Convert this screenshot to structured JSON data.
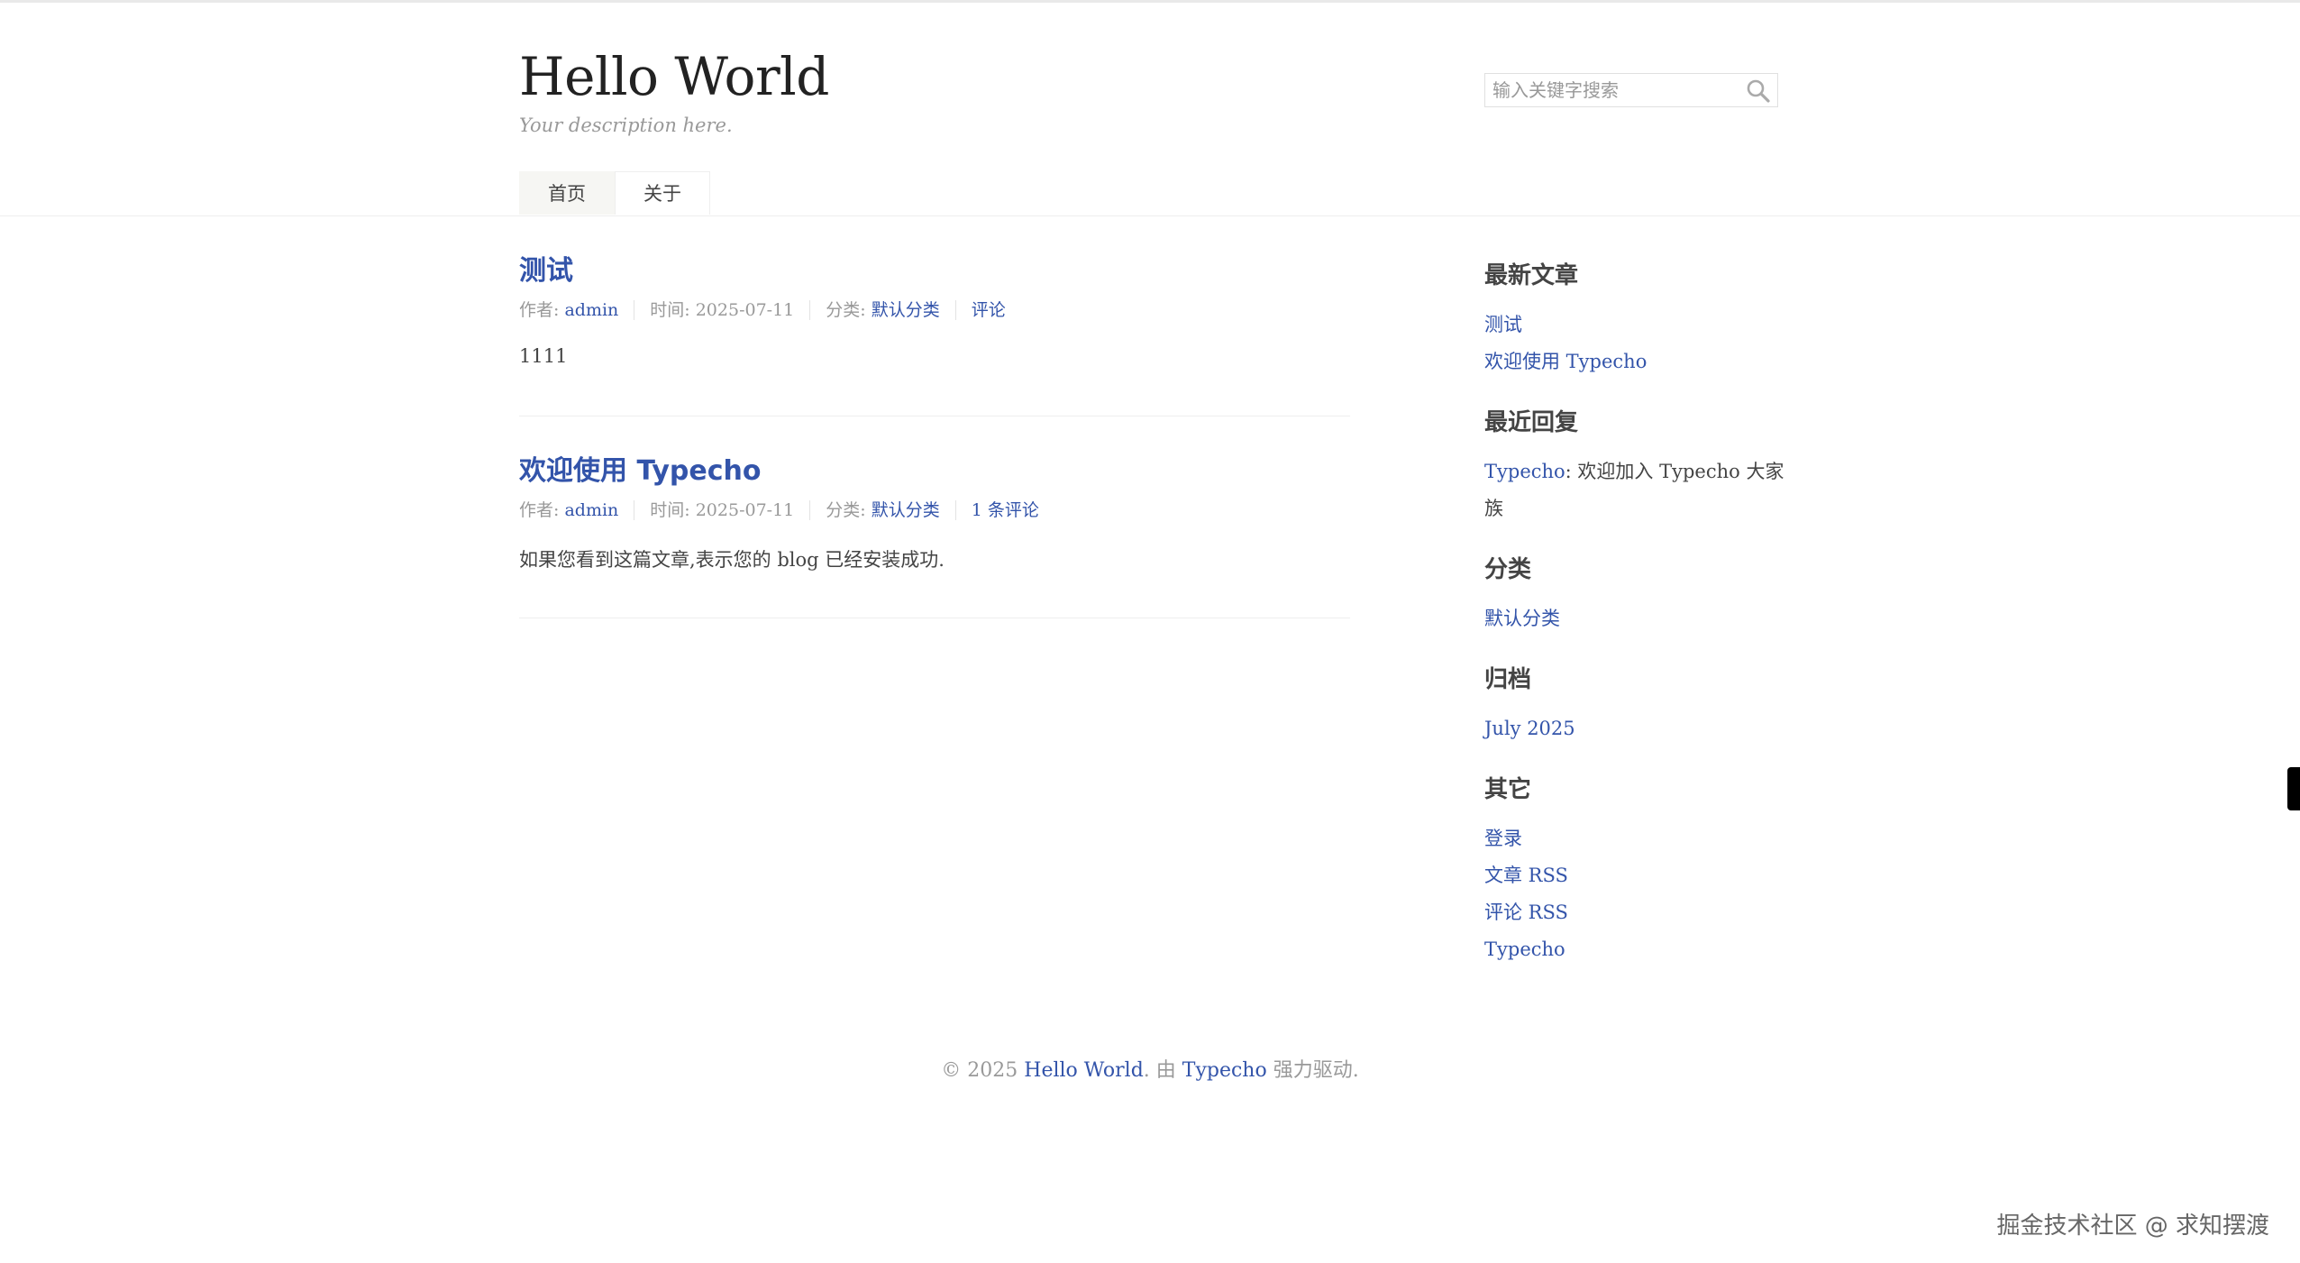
{
  "site": {
    "title": "Hello World",
    "description": "Your description here."
  },
  "search": {
    "placeholder": "输入关键字搜索",
    "icon": "search-icon"
  },
  "nav": [
    {
      "label": "首页",
      "current": true
    },
    {
      "label": "关于",
      "current": false
    }
  ],
  "posts": [
    {
      "title": "测试",
      "author_label": "作者: ",
      "author": "admin",
      "time": "时间: 2025-07-11",
      "category_label": "分类: ",
      "category": "默认分类",
      "comments": "评论",
      "content": "1111"
    },
    {
      "title": "欢迎使用 Typecho",
      "author_label": "作者: ",
      "author": "admin",
      "time": "时间: 2025-07-11",
      "category_label": "分类: ",
      "category": "默认分类",
      "comments": "1 条评论",
      "content": "如果您看到这篇文章,表示您的 blog 已经安装成功."
    }
  ],
  "sidebar": {
    "recent_posts": {
      "title": "最新文章",
      "items": [
        "测试",
        "欢迎使用 Typecho"
      ]
    },
    "recent_comments": {
      "title": "最近回复",
      "author": "Typecho",
      "text": ": 欢迎加入 Typecho 大家族"
    },
    "categories": {
      "title": "分类",
      "items": [
        "默认分类"
      ]
    },
    "archives": {
      "title": "归档",
      "items": [
        "July 2025"
      ]
    },
    "other": {
      "title": "其它",
      "items": [
        "登录",
        "文章 RSS",
        "评论 RSS",
        "Typecho"
      ]
    }
  },
  "footer": {
    "copyright": "© 2025 ",
    "site_link": "Hello World",
    "by": ". 由 ",
    "engine_link": "Typecho",
    "powered": " 强力驱动."
  },
  "watermark": "掘金技术社区 @ 求知摆渡",
  "colors": {
    "link": "#3354aa",
    "text": "#444444",
    "muted": "#999999"
  }
}
